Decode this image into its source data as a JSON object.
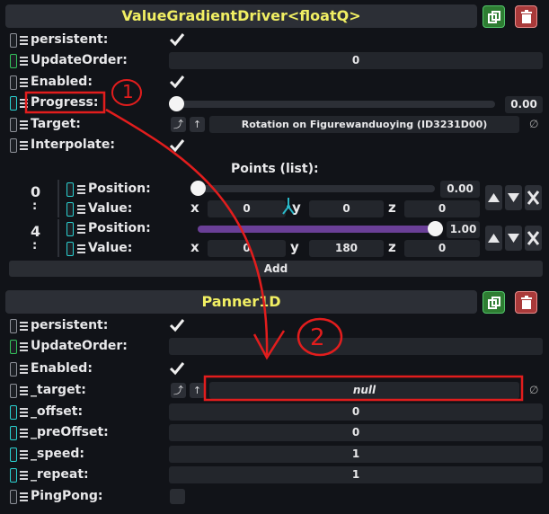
{
  "component1": {
    "title": "ValueGradientDriver<floatQ>",
    "fields": {
      "persistent": "persistent:",
      "update_order": "UpdateOrder:",
      "update_order_value": "0",
      "enabled": "Enabled:",
      "progress": "Progress:",
      "progress_value": "0.00",
      "progress_level": 0.0,
      "target": "Target:",
      "target_value": "Rotation on Figurewanduoying (ID3231D00)",
      "interpolate": "Interpolate:"
    },
    "points_header": "Points (list):",
    "points": [
      {
        "index": "0",
        "index_sep": ":",
        "position_label": "Position:",
        "position_value": "0.00",
        "position_level": 0.0,
        "value_label": "Value:",
        "x": "0",
        "y": "0",
        "z": "0"
      },
      {
        "index": "4",
        "index_sep": ":",
        "position_label": "Position:",
        "position_value": "1.00",
        "position_level": 1.0,
        "value_label": "Value:",
        "x": "0",
        "y": "180",
        "z": "0"
      }
    ],
    "axes": {
      "x": "x",
      "y": "y",
      "z": "z"
    },
    "add_label": "Add"
  },
  "component2": {
    "title": "Panner1D",
    "fields": {
      "persistent": "persistent:",
      "update_order": "UpdateOrder:",
      "enabled": "Enabled:",
      "target": "_target:",
      "target_value": "null",
      "offset": "_offset:",
      "offset_value": "0",
      "pre_offset": "_preOffset:",
      "pre_offset_value": "0",
      "speed": "_speed:",
      "speed_value": "1",
      "repeat": "_repeat:",
      "repeat_value": "1",
      "ping_pong": "PingPong:"
    }
  },
  "annotations": {
    "mark1": "1",
    "mark2": "2"
  },
  "colors": {
    "background": "#111318",
    "title": "#f1ef63",
    "annotation": "#e21d1d",
    "slider_fill": "#6a3f97"
  }
}
